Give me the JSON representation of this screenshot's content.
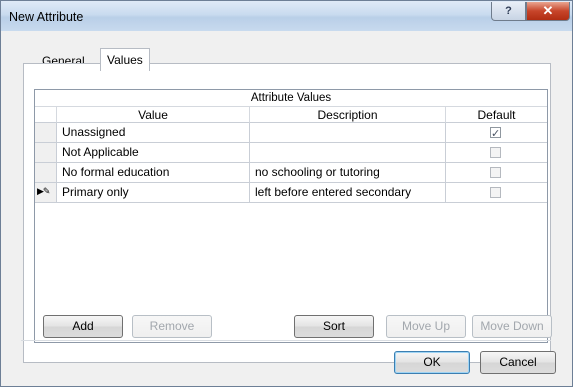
{
  "window": {
    "title": "New Attribute",
    "help_glyph": "?",
    "close_glyph": "✕"
  },
  "tabs": [
    {
      "label": "General"
    },
    {
      "label": "Values"
    }
  ],
  "grid": {
    "title": "Attribute Values",
    "columns": [
      "Value",
      "Description",
      "Default"
    ],
    "rows": [
      {
        "value": "Unassigned",
        "description": "",
        "default": true
      },
      {
        "value": "Not Applicable",
        "description": "",
        "default": false
      },
      {
        "value": "No formal education",
        "description": "no schooling or tutoring",
        "default": false
      },
      {
        "value": "Primary only",
        "description": "left before entered secondary",
        "default": false,
        "indicator": "▶✎"
      }
    ]
  },
  "buttons": {
    "add": "Add",
    "remove": "Remove",
    "sort": "Sort",
    "move_up": "Move Up",
    "move_down": "Move Down",
    "ok": "OK",
    "cancel": "Cancel"
  },
  "colors": {
    "close_button": "#c7452a",
    "default_button_border": "#3c7fb1"
  }
}
